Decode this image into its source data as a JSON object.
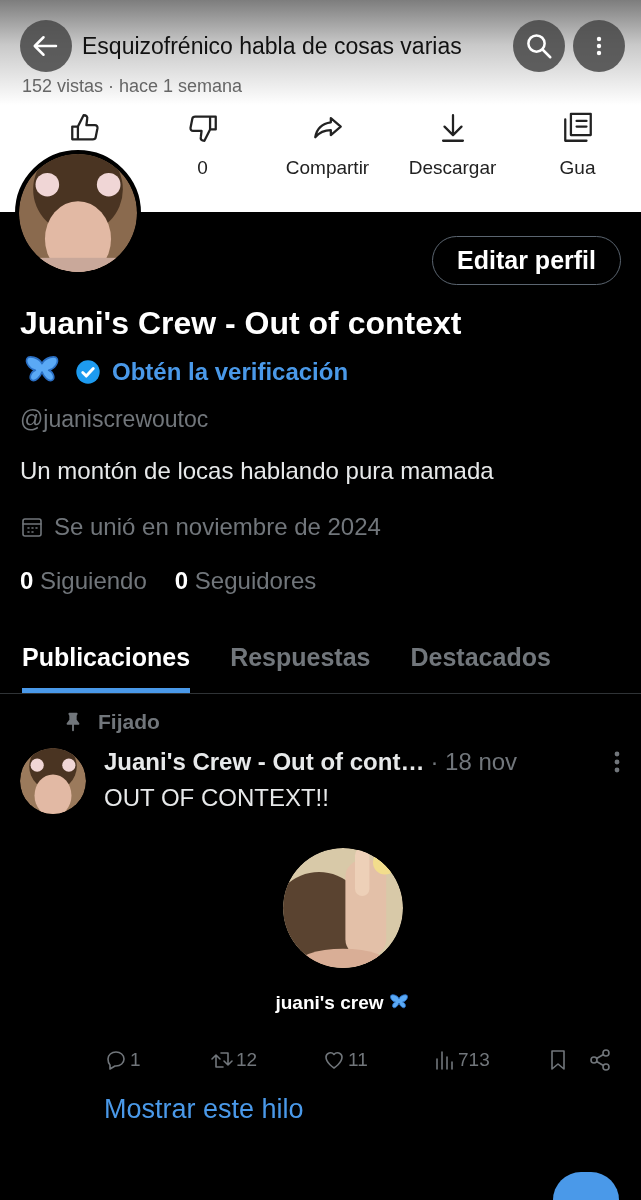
{
  "video_header": {
    "title": "Esquizofrénico habla de cosas varias",
    "meta": "152 vistas · hace 1 semana",
    "actions": [
      {
        "kind": "like"
      },
      {
        "kind": "dislike",
        "label": "0"
      },
      {
        "kind": "share",
        "label": "Compartir"
      },
      {
        "kind": "download",
        "label": "Descargar"
      },
      {
        "kind": "save",
        "label": "Gua"
      }
    ]
  },
  "profile": {
    "edit_button": "Editar perfil",
    "name": "Juani's Crew - Out of context",
    "verify_link": "Obtén la verificación",
    "handle": "@juaniscrewoutoc",
    "bio": "Un montón de locas hablando pura mamada",
    "joined": "Se unió en noviembre de 2024",
    "stats": [
      {
        "count": "0",
        "label": "Siguiendo"
      },
      {
        "count": "0",
        "label": "Seguidores"
      }
    ]
  },
  "tabs": [
    {
      "label": "Publicaciones",
      "selected": true
    },
    {
      "label": "Respuestas",
      "selected": false
    },
    {
      "label": "Destacados",
      "selected": false
    }
  ],
  "pinned_post": {
    "pinned_label": "Fijado",
    "author": "Juani's Crew - Out of cont…",
    "date": "· 18 nov",
    "text": "OUT OF CONTEXT!!",
    "media_caption": "juani's crew",
    "actions": [
      {
        "kind": "reply",
        "count": "1"
      },
      {
        "kind": "repost",
        "count": "12"
      },
      {
        "kind": "like",
        "count": "11"
      },
      {
        "kind": "views",
        "count": "713"
      },
      {
        "kind": "bookmark"
      },
      {
        "kind": "share"
      }
    ],
    "thread_link": "Mostrar este hilo"
  }
}
